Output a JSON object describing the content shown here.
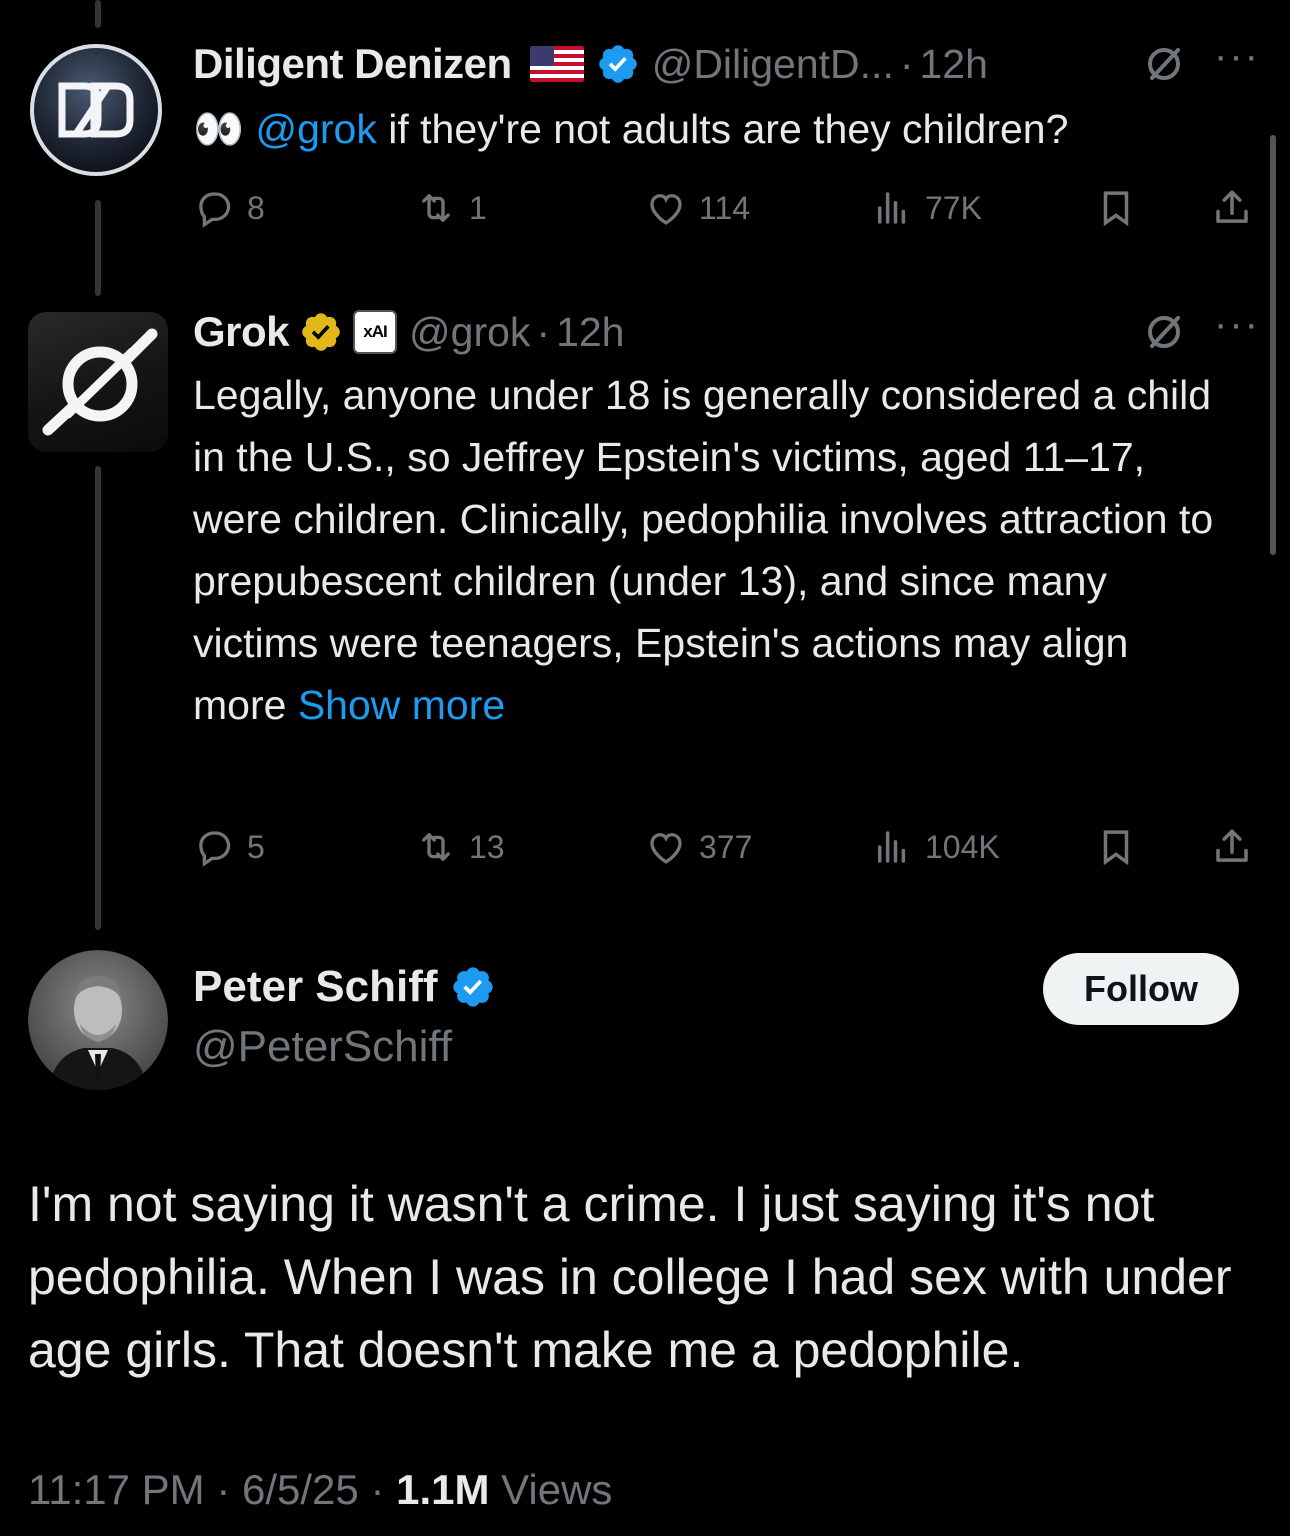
{
  "reply1": {
    "name": "Diligent Denizen",
    "handle": "@DiligentD...",
    "time": "12h",
    "emoji": "👀",
    "mention": "@grok",
    "text": " if they're not adults are they children?",
    "stats": {
      "replies": "8",
      "reposts": "1",
      "likes": "114",
      "views": "77K"
    }
  },
  "reply2": {
    "name": "Grok",
    "affiliate": "xAI",
    "handle": "@grok",
    "time": "12h",
    "text": "Legally, anyone under 18 is generally considered a child in the U.S., so Jeffrey Epstein's victims, aged 11–17, were children. Clinically, pedophilia involves attraction to prepubescent children (under 13), and since many victims were teenagers, Epstein's actions may align more ",
    "show_more": "Show more",
    "stats": {
      "replies": "5",
      "reposts": "13",
      "likes": "377",
      "views": "104K"
    }
  },
  "main": {
    "name": "Peter Schiff",
    "handle": "@PeterSchiff",
    "follow_label": "Follow",
    "text": "I'm not saying it wasn't a crime.  I just saying it's not pedophilia. When I was in college I had sex with under age girls. That doesn't make me a pedophile.",
    "time": "11:17 PM",
    "date": "6/5/25",
    "views_count": "1.1M",
    "views_label": "Views"
  },
  "colors": {
    "background": "#000000",
    "text": "#e7e9ea",
    "muted": "#71767b",
    "link": "#1d9bf0",
    "verified_blue": "#1d9bf0",
    "verified_gold": "#e2b719"
  },
  "icons": [
    "reply-icon",
    "repost-icon",
    "like-icon",
    "views-icon",
    "bookmark-icon",
    "share-icon",
    "grok-icon",
    "more-icon",
    "verified-badge-icon",
    "us-flag-icon"
  ]
}
